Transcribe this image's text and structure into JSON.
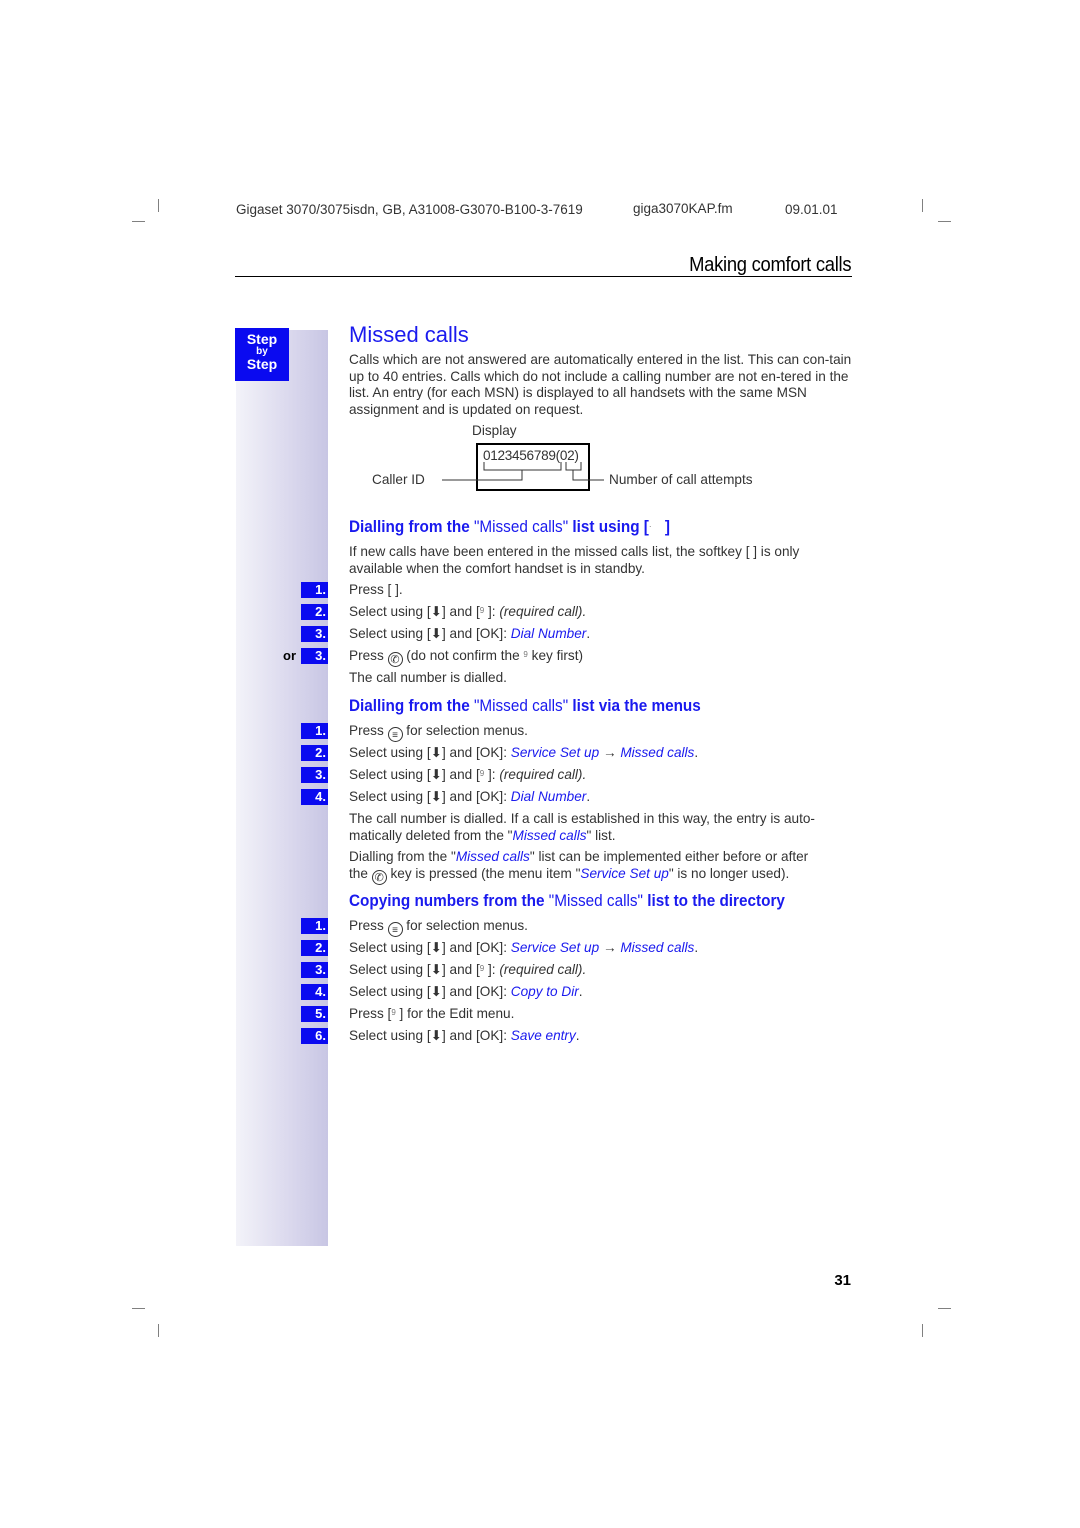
{
  "header": {
    "doc_ref": "Gigaset 3070/3075isdn, GB, A31008-G3070-B100-3-7619",
    "file": "giga3070KAP.fm",
    "date": "09.01.01",
    "section": "Making comfort calls"
  },
  "sidebar": {
    "badge": {
      "line1": "Step",
      "line2": "by",
      "line3": "Step"
    },
    "or_label": "or"
  },
  "main": {
    "title": "Missed calls",
    "intro": "Calls which are not answered are automatically entered in the list. This can con-tain up to 40 entries. Calls which do not include a calling number are not en-tered in the list. An entry (for each MSN) is displayed to all handsets with the same MSN assignment and is updated on request.",
    "diagram": {
      "display_label": "Display",
      "display_value": "0123456789(02)",
      "caller_id_label": "Caller ID",
      "attempts_label": "Number of call attempts"
    },
    "section1": {
      "heading_a": "Dialling from the ",
      "heading_b": "\"Missed calls\"",
      "heading_c": " list using [",
      "heading_d": " ]",
      "note": "If new calls have been entered in the missed calls list, the softkey [    ] is only available when the comfort handset is in standby.",
      "steps": [
        {
          "num": "1.",
          "text": "Press [    ]."
        },
        {
          "num": "2.",
          "pre": "Select using [",
          "arrow": "⬇",
          "mid": "] and [",
          "key": "9",
          "post": "   ]: ",
          "em": "(required call)."
        },
        {
          "num": "3.",
          "pre": "Select using [",
          "arrow": "⬇",
          "mid": "] and [OK]: ",
          "link": "Dial Number",
          "post": "."
        },
        {
          "num": "3.",
          "pre": "Press ",
          "post": " (do not confirm the ",
          "key": "9",
          "tail": "    key first)"
        }
      ],
      "result": "The call number is dialled."
    },
    "section2": {
      "heading_a": "Dialling from the ",
      "heading_b": "\"Missed calls\"",
      "heading_c": " list via the menus",
      "steps": [
        {
          "num": "1.",
          "pre": "Press ",
          "post": " for selection menus."
        },
        {
          "num": "2.",
          "pre": "Select using [",
          "arrow": "⬇",
          "mid": "] and [OK]: ",
          "link1": "Service Set up",
          "sep": " → ",
          "link2": "Missed calls",
          "post": "."
        },
        {
          "num": "3.",
          "pre": "Select using [",
          "arrow": "⬇",
          "mid": "] and [",
          "key": "9",
          "post": "   ]: ",
          "em": "(required call)."
        },
        {
          "num": "4.",
          "pre": "Select using [",
          "arrow": "⬇",
          "mid": "] and [OK]: ",
          "link": "Dial Number",
          "post": "."
        }
      ],
      "para1_a": "The call number is dialled. If a call is established in this way, the entry is auto-matically deleted from the \"",
      "para1_link": "Missed calls",
      "para1_b": "\" list.",
      "para2_a": "Dialling from the \"",
      "para2_link": "Missed calls",
      "para2_b": "\" list can be implemented either before or after",
      "para3_a": "the ",
      "para3_b": " key is pressed (the menu item \"",
      "para3_link": "Service Set up",
      "para3_c": "\" is no longer used)."
    },
    "section3": {
      "heading_a": "Copying numbers from the ",
      "heading_b": "\"Missed calls\"",
      "heading_c": " list to the directory",
      "steps": [
        {
          "num": "1.",
          "pre": "Press ",
          "post": " for selection menus."
        },
        {
          "num": "2.",
          "pre": "Select using [",
          "arrow": "⬇",
          "mid": "] and [OK]: ",
          "link1": "Service Set up",
          "sep": " → ",
          "link2": "Missed calls",
          "post": "."
        },
        {
          "num": "3.",
          "pre": "Select using [",
          "arrow": "⬇",
          "mid": "] and [",
          "key": "9",
          "post": "   ]: ",
          "em": "(required call)."
        },
        {
          "num": "4.",
          "pre": "Select using [",
          "arrow": "⬇",
          "mid": "] and [OK]: ",
          "link": "Copy to Dir",
          "post": "."
        },
        {
          "num": "5.",
          "pre": "Press [",
          "key": "9",
          "post": "   ] for the Edit menu."
        },
        {
          "num": "6.",
          "pre": "Select using [",
          "arrow": "⬇",
          "mid": "] and [OK]: ",
          "link": "Save entry",
          "post": "."
        }
      ]
    }
  },
  "footer": {
    "page_number": "31"
  },
  "colors": {
    "accent_blue": "#1a1aee",
    "badge_blue": "#0a0af0"
  }
}
